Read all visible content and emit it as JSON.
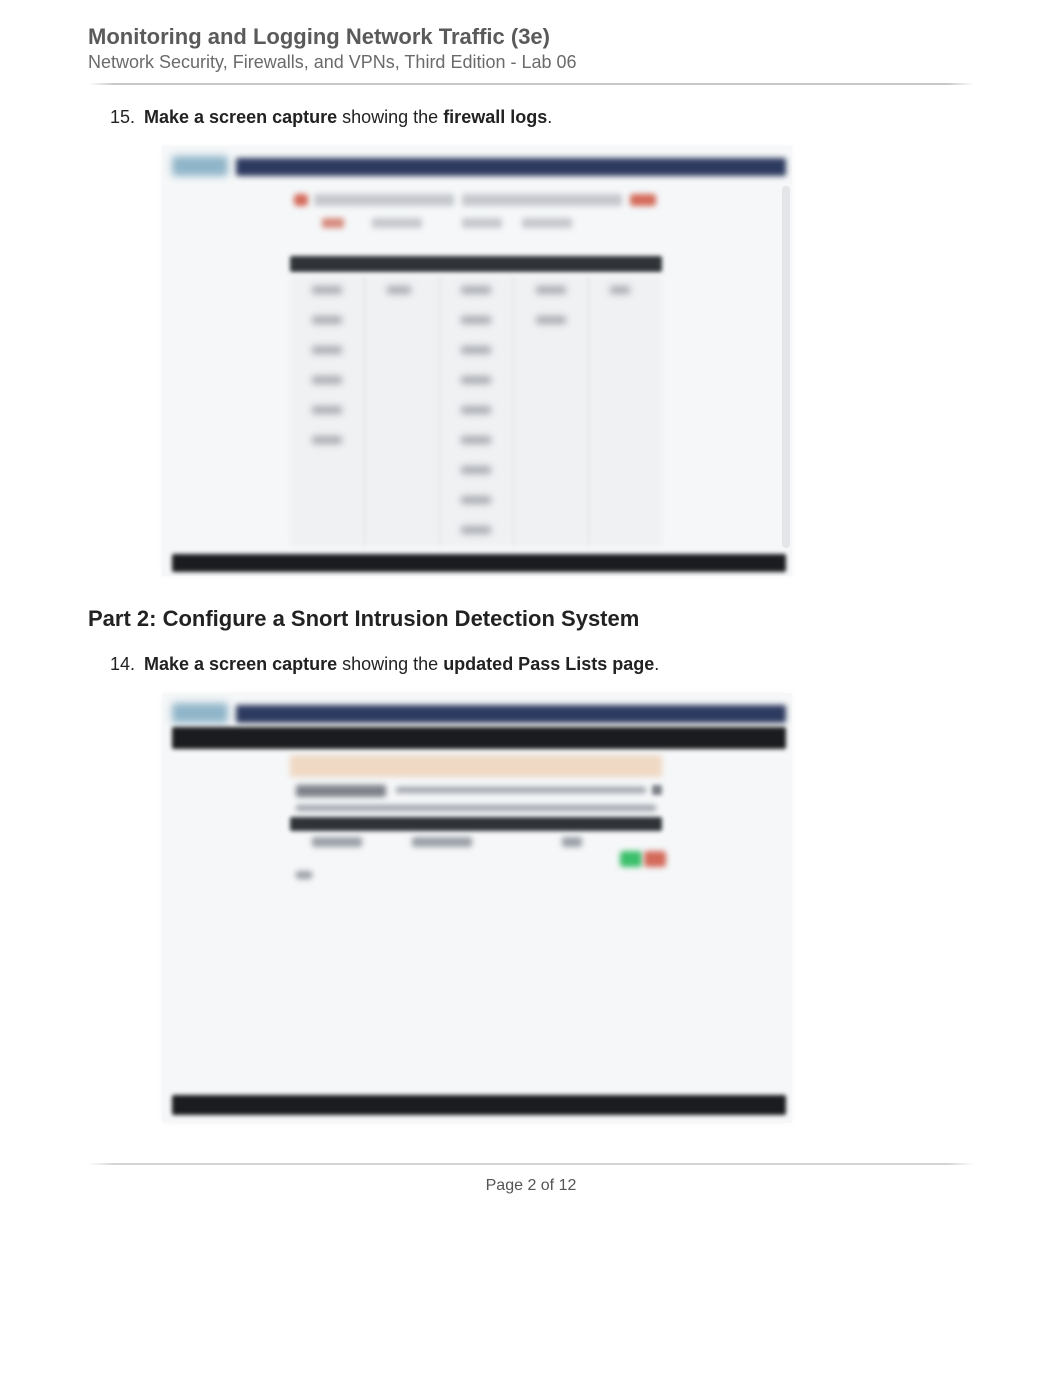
{
  "header": {
    "title": "Monitoring and Logging Network Traffic (3e)",
    "subtitle": "Network Security, Firewalls, and VPNs, Third Edition - Lab 06"
  },
  "item15": {
    "number": "15.",
    "bold1": "Make a screen capture",
    "mid": " showing the ",
    "bold2": "firewall logs",
    "end": "."
  },
  "part2_heading": "Part 2: Configure a Snort Intrusion Detection System",
  "item14": {
    "number": "14.",
    "bold1": "Make a screen capture",
    "mid": " showing the ",
    "bold2": "updated Pass Lists page",
    "end": "."
  },
  "footer": {
    "page_label": "Page 2 of 12"
  }
}
